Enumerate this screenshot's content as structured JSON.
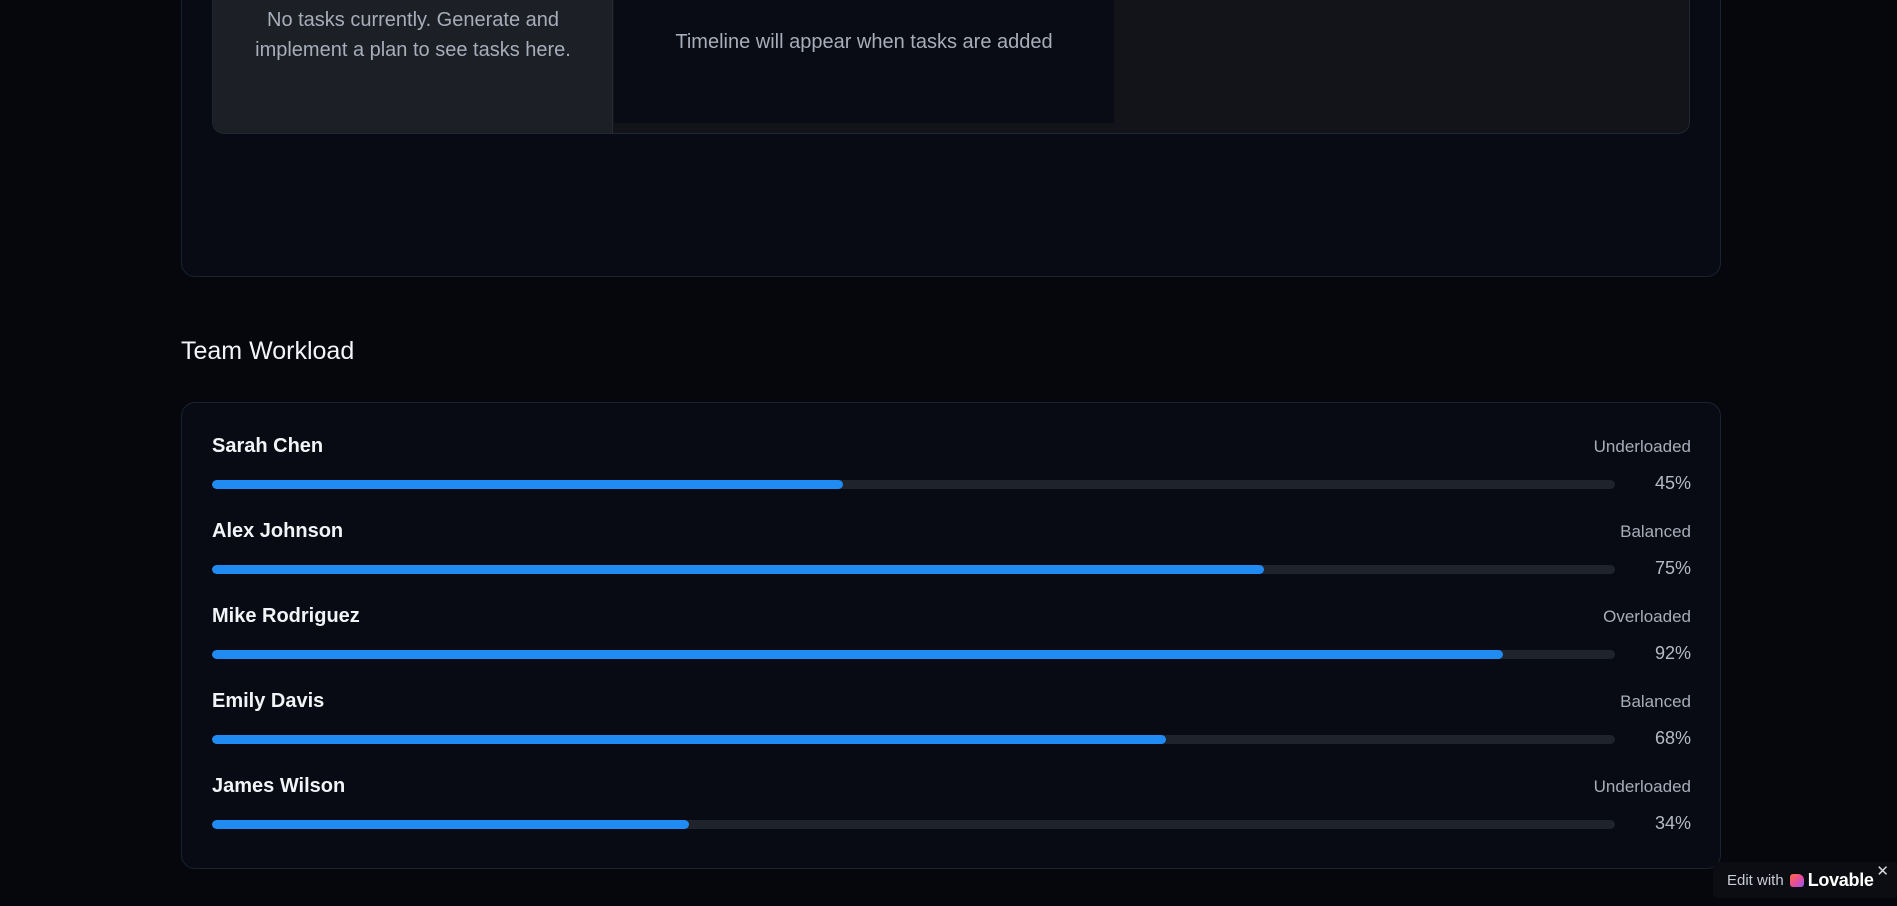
{
  "task_panel": {
    "empty_message": "No tasks currently. Generate and implement a plan to see tasks here."
  },
  "timeline_panel": {
    "empty_message": "Timeline will appear when tasks are added"
  },
  "team_workload": {
    "title": "Team Workload",
    "members": [
      {
        "name": "Sarah Chen",
        "status": "Underloaded",
        "percent_label": "45%",
        "percent": 45
      },
      {
        "name": "Alex Johnson",
        "status": "Balanced",
        "percent_label": "75%",
        "percent": 75
      },
      {
        "name": "Mike Rodriguez",
        "status": "Overloaded",
        "percent_label": "92%",
        "percent": 92
      },
      {
        "name": "Emily Davis",
        "status": "Balanced",
        "percent_label": "68%",
        "percent": 68
      },
      {
        "name": "James Wilson",
        "status": "Underloaded",
        "percent_label": "34%",
        "percent": 34
      }
    ]
  },
  "badge": {
    "prefix": "Edit with",
    "brand": "Lovable",
    "close": "✕"
  },
  "colors": {
    "bar_fill": "#1f8bf3",
    "bar_track": "#1f232b",
    "background": "#05070c"
  }
}
